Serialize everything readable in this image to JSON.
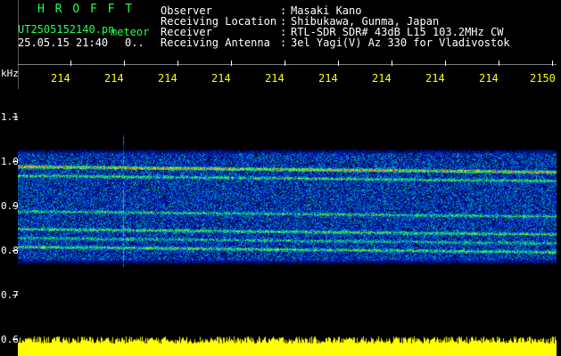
{
  "header": {
    "app_name": "H R O F F T",
    "filename": "UT2505152140.pn",
    "tag": "meteor",
    "datetime": "25.05.15 21:40",
    "counter": "0..",
    "fields": [
      {
        "label": "Observer",
        "value": "Masaki Kano"
      },
      {
        "label": "Receiving Location",
        "value": "Shibukawa, Gunma, Japan"
      },
      {
        "label": "Receiver",
        "value": "RTL-SDR SDR# 43dB L15 103.2MHz CW"
      },
      {
        "label": "Receiving Antenna",
        "value": "3el Yagi(V) Az 330 for Vladivostok"
      }
    ],
    "separator": ":"
  },
  "axis": {
    "unit": "kHz",
    "y_labels": [
      "1.1",
      "1.0",
      "0.9",
      "0.8",
      "0.7",
      "0.6"
    ],
    "x_labels": [
      "214",
      "214",
      "214",
      "214",
      "214",
      "214",
      "214",
      "214",
      "214",
      "2150"
    ]
  },
  "colors": {
    "title": "#22ff55",
    "time_labels": "#ffff00",
    "amplitude": "#ffff00",
    "background": "#000000",
    "noise": "#0a1a8a"
  },
  "spectrogram": {
    "bands_khz": [
      0.99,
      0.97,
      0.89,
      0.85,
      0.83,
      0.81
    ],
    "band_levels": [
      0.9,
      0.5,
      0.45,
      0.55,
      0.4,
      0.55
    ],
    "freq_range_khz": [
      0.6,
      1.15
    ]
  }
}
